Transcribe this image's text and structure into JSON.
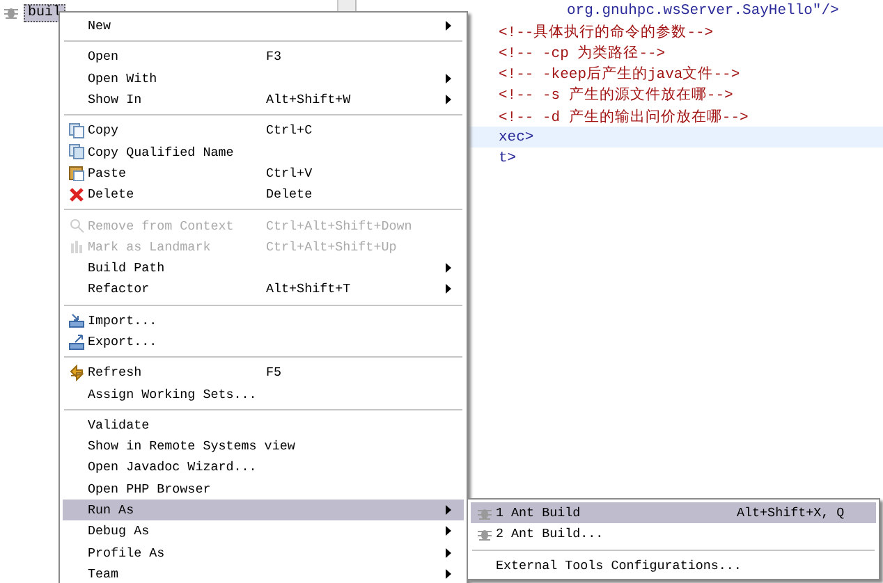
{
  "tree": {
    "item": {
      "label": "buil",
      "selected": true
    }
  },
  "editor": {
    "lines": [
      {
        "kind": "code",
        "text": "org.gnuhpc.wsServer.SayHello\"/>",
        "indent": true,
        "current": false
      },
      {
        "kind": "comment",
        "text": "<!--具体执行的命令的参数-->",
        "indent": false,
        "current": false
      },
      {
        "kind": "comment",
        "text": "<!-- -cp 为类路径-->",
        "indent": false,
        "current": false
      },
      {
        "kind": "comment",
        "text": "<!-- -keep后产生的java文件-->",
        "indent": false,
        "current": false
      },
      {
        "kind": "comment",
        "text": "<!-- -s 产生的源文件放在哪-->",
        "indent": false,
        "current": false
      },
      {
        "kind": "comment",
        "text": "<!-- -d 产生的输出问价放在哪-->",
        "indent": false,
        "current": false
      },
      {
        "kind": "code",
        "text": "xec>",
        "indent": false,
        "current": true
      },
      {
        "kind": "code",
        "text": "t>",
        "indent": false,
        "current": false
      }
    ]
  },
  "context_menu": {
    "items": [
      {
        "kind": "item",
        "label": "New",
        "submenu": true,
        "disabled": false,
        "selected": false
      },
      {
        "kind": "separator"
      },
      {
        "kind": "item",
        "label": "Open",
        "shortcut": "F3",
        "submenu": false,
        "disabled": false,
        "selected": false
      },
      {
        "kind": "item",
        "label": "Open With",
        "submenu": true,
        "disabled": false,
        "selected": false
      },
      {
        "kind": "item",
        "label": "Show In",
        "shortcut": "Alt+Shift+W",
        "submenu": true,
        "disabled": false,
        "selected": false
      },
      {
        "kind": "separator"
      },
      {
        "kind": "item",
        "label": "Copy",
        "shortcut": "Ctrl+C",
        "submenu": false,
        "disabled": false,
        "selected": false
      },
      {
        "kind": "item",
        "label": "Copy Qualified Name",
        "submenu": false,
        "disabled": false,
        "selected": false
      },
      {
        "kind": "item",
        "label": "Paste",
        "shortcut": "Ctrl+V",
        "submenu": false,
        "disabled": false,
        "selected": false
      },
      {
        "kind": "item",
        "label": "Delete",
        "shortcut": "Delete",
        "submenu": false,
        "disabled": false,
        "selected": false
      },
      {
        "kind": "separator"
      },
      {
        "kind": "item",
        "label": "Remove from Context",
        "shortcut": "Ctrl+Alt+Shift+Down",
        "submenu": false,
        "disabled": true,
        "selected": false
      },
      {
        "kind": "item",
        "label": "Mark as Landmark",
        "shortcut": "Ctrl+Alt+Shift+Up",
        "submenu": false,
        "disabled": true,
        "selected": false
      },
      {
        "kind": "item",
        "label": "Build Path",
        "submenu": true,
        "disabled": false,
        "selected": false
      },
      {
        "kind": "item",
        "label": "Refactor",
        "shortcut": "Alt+Shift+T",
        "submenu": true,
        "disabled": false,
        "selected": false
      },
      {
        "kind": "separator"
      },
      {
        "kind": "item",
        "label": "Import...",
        "submenu": false,
        "disabled": false,
        "selected": false
      },
      {
        "kind": "item",
        "label": "Export...",
        "submenu": false,
        "disabled": false,
        "selected": false
      },
      {
        "kind": "separator"
      },
      {
        "kind": "item",
        "label": "Refresh",
        "shortcut": "F5",
        "submenu": false,
        "disabled": false,
        "selected": false
      },
      {
        "kind": "item",
        "label": "Assign Working Sets...",
        "submenu": false,
        "disabled": false,
        "selected": false
      },
      {
        "kind": "separator"
      },
      {
        "kind": "item",
        "label": "Validate",
        "submenu": false,
        "disabled": false,
        "selected": false
      },
      {
        "kind": "item",
        "label": "Show in Remote Systems view",
        "submenu": false,
        "disabled": false,
        "selected": false
      },
      {
        "kind": "item",
        "label": "Open Javadoc Wizard...",
        "submenu": false,
        "disabled": false,
        "selected": false
      },
      {
        "kind": "item",
        "label": "Open PHP Browser",
        "submenu": false,
        "disabled": false,
        "selected": false
      },
      {
        "kind": "item",
        "label": "Run As",
        "submenu": true,
        "disabled": false,
        "selected": true
      },
      {
        "kind": "item",
        "label": "Debug As",
        "submenu": true,
        "disabled": false,
        "selected": false
      },
      {
        "kind": "item",
        "label": "Profile As",
        "submenu": true,
        "disabled": false,
        "selected": false
      },
      {
        "kind": "item",
        "label": "Team",
        "submenu": true,
        "disabled": false,
        "selected": false
      }
    ]
  },
  "submenu": {
    "items": [
      {
        "kind": "item",
        "label": "1 Ant Build",
        "shortcut": "Alt+Shift+X, Q",
        "selected": true
      },
      {
        "kind": "item",
        "label": "2 Ant Build...",
        "selected": false
      },
      {
        "kind": "separator"
      },
      {
        "kind": "item",
        "label": "External Tools Configurations...",
        "selected": false
      }
    ]
  }
}
